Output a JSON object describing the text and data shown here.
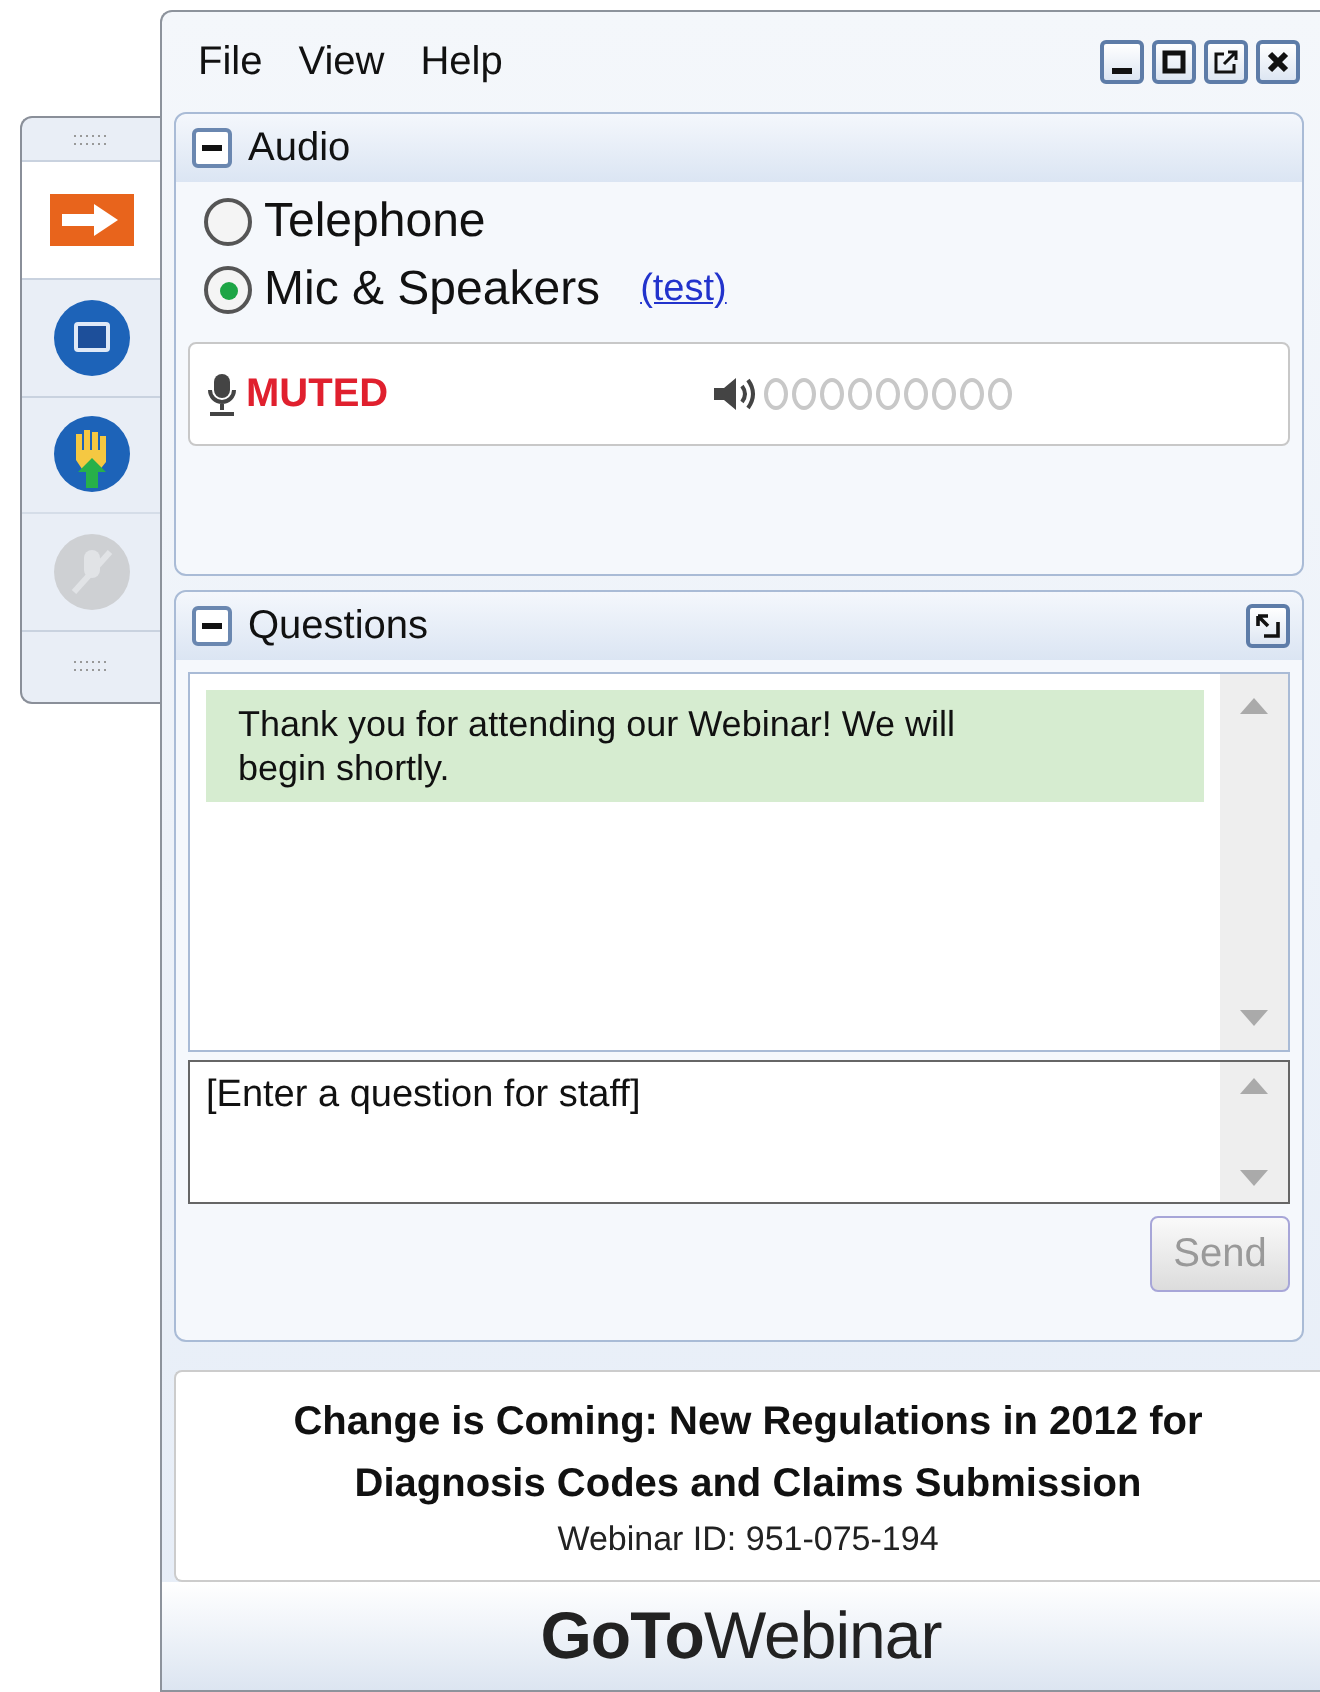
{
  "menu": [
    "File",
    "View",
    "Help"
  ],
  "toolbar": [
    {
      "kind": "arrow",
      "disabled": false
    },
    {
      "kind": "screen",
      "disabled": false
    },
    {
      "kind": "hand",
      "disabled": false
    },
    {
      "kind": "mic",
      "disabled": true
    }
  ],
  "audio": {
    "title": "Audio",
    "expanded": true,
    "options": [
      {
        "label": "Telephone",
        "selected": false
      },
      {
        "label": "Mic & Speakers",
        "selected": true
      }
    ],
    "test_link": "(test)",
    "mic_status": "MUTED"
  },
  "questions": {
    "title": "Questions",
    "expanded": true,
    "messages": [
      "Thank you for attending our Webinar! We will begin shortly."
    ],
    "input": {
      "placeholder": "[Enter a question for staff]"
    },
    "send": {
      "label": "Send",
      "disabled": true
    }
  },
  "info": {
    "title": "Change is Coming: New Regulations in 2012 for Diagnosis Codes and Claims Submission",
    "webinar_id": "Webinar ID: 951-075-194"
  },
  "logo": "**GoTo**Webinar"
}
